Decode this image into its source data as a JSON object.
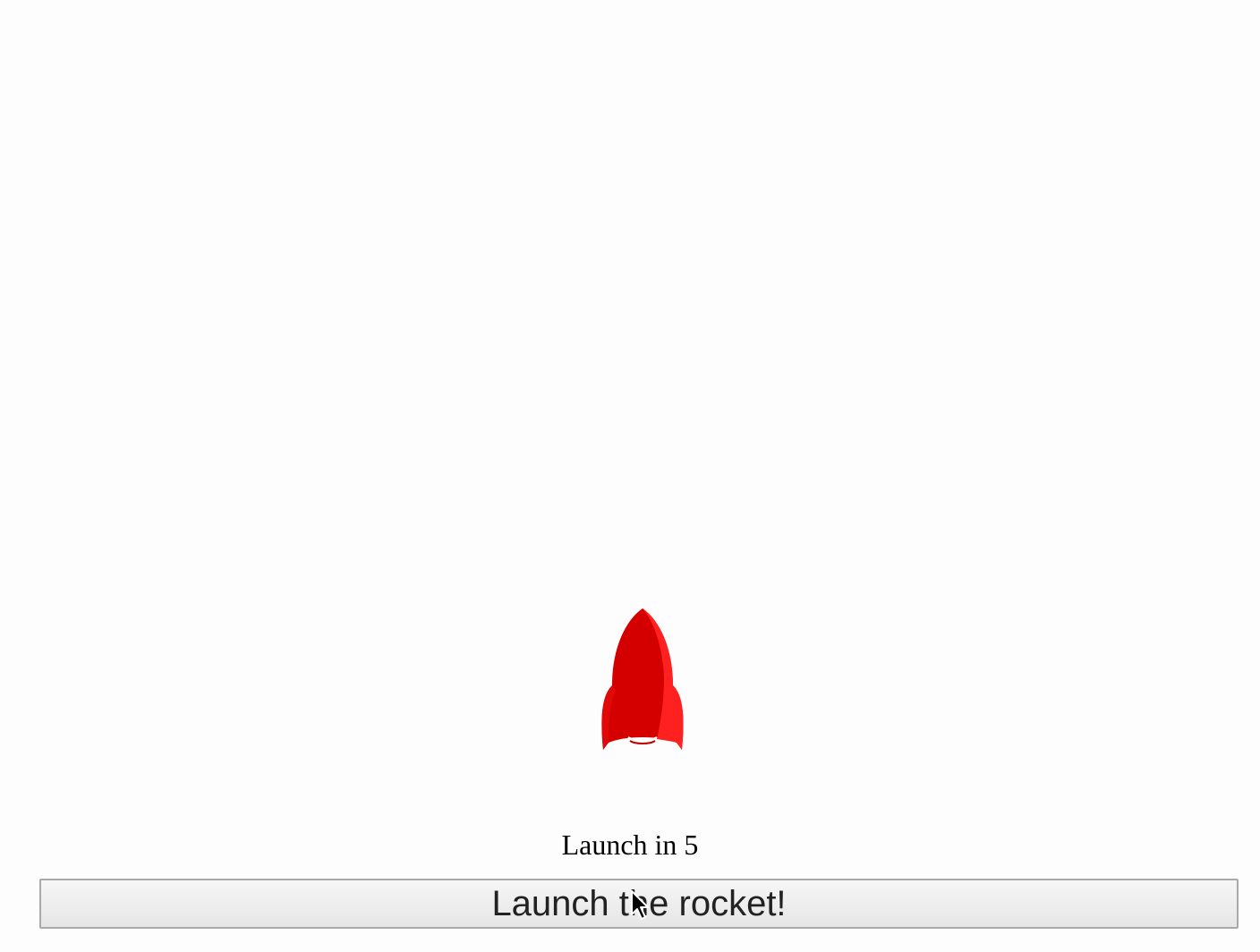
{
  "countdown": {
    "text": "Launch in 5"
  },
  "launch_button": {
    "label": "Launch the rocket!"
  },
  "rocket": {
    "icon": "rocket-icon",
    "color_main": "#d40000",
    "color_highlight": "#ff2020"
  },
  "cursor": {
    "icon": "mouse-pointer-icon"
  }
}
